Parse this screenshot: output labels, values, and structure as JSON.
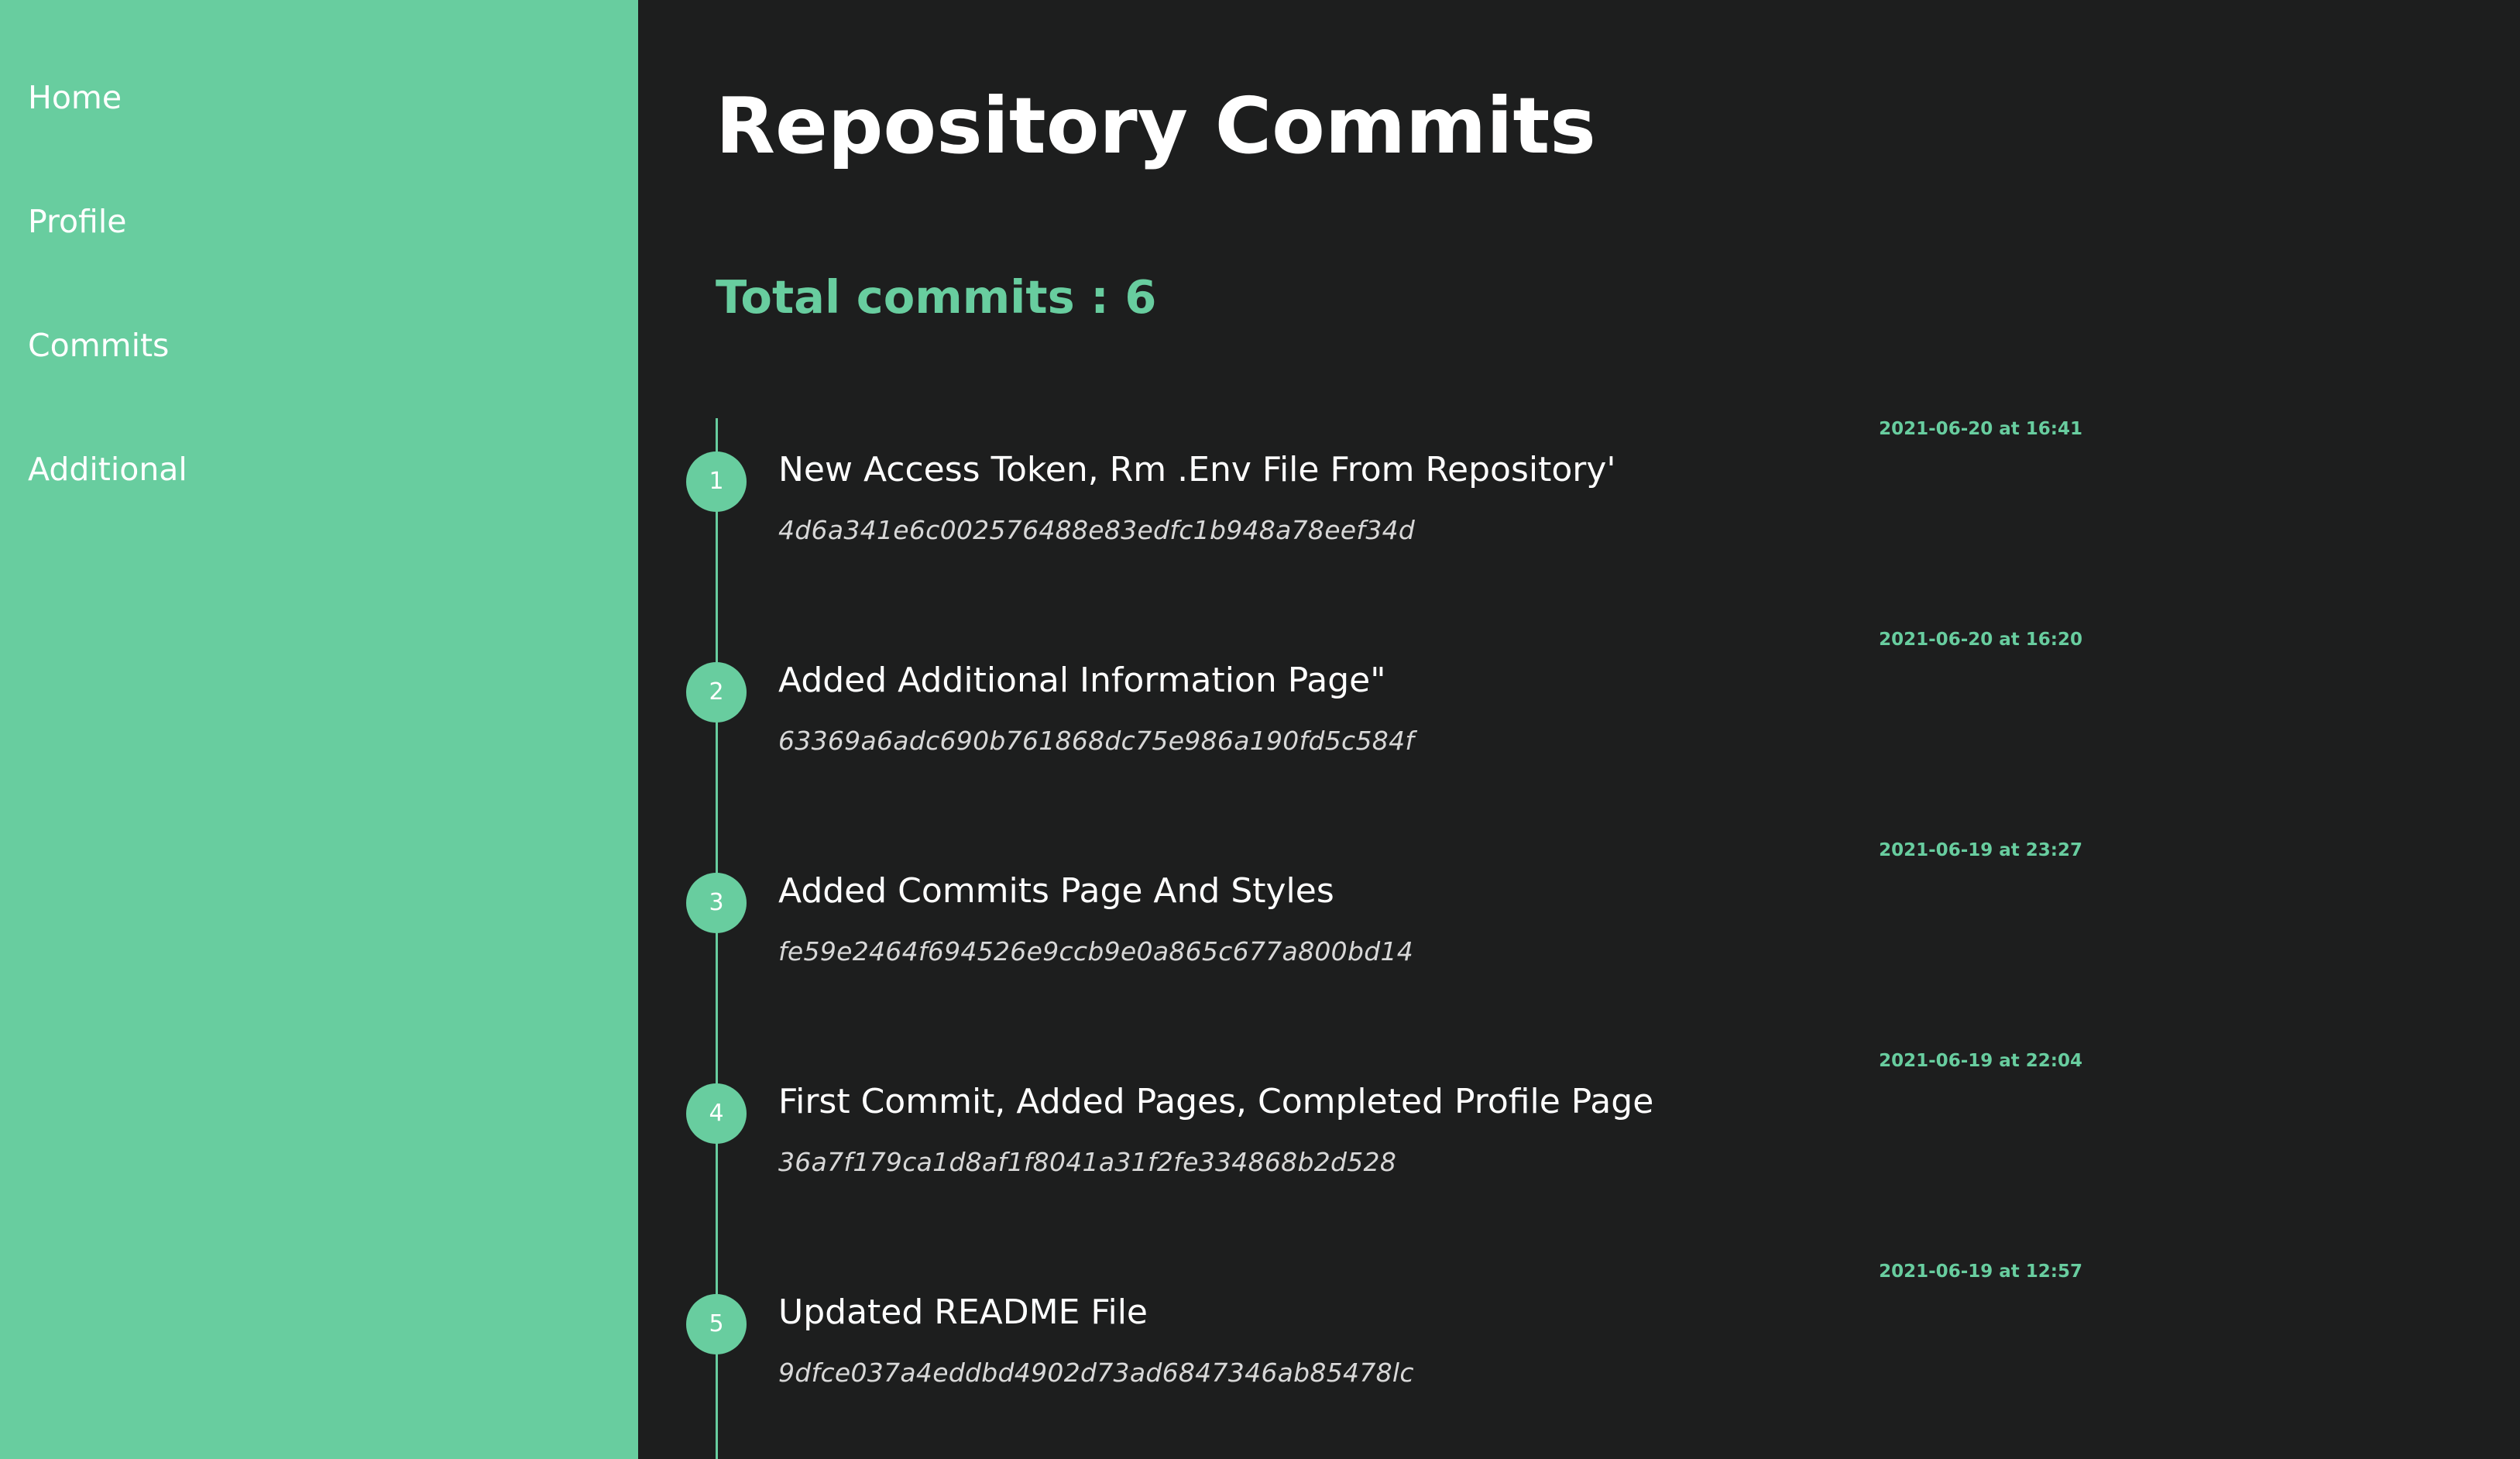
{
  "sidebar": {
    "items": [
      {
        "label": "Home"
      },
      {
        "label": "Profile"
      },
      {
        "label": "Commits"
      },
      {
        "label": "Additional"
      }
    ]
  },
  "main": {
    "title": "Repository Commits",
    "total_label": "Total commits : 6"
  },
  "commits": [
    {
      "number": "1",
      "message": "New Access Token, Rm .Env File From Repository'",
      "sha": "4d6a341e6c002576488e83edfc1b948a78eef34d",
      "date": "2021-06-20 at 16:41"
    },
    {
      "number": "2",
      "message": "Added Additional Information Page\"",
      "sha": "63369a6adc690b761868dc75e986a190fd5c584f",
      "date": "2021-06-20 at 16:20"
    },
    {
      "number": "3",
      "message": "Added Commits Page And Styles",
      "sha": "fe59e2464f694526e9ccb9e0a865c677a800bd14",
      "date": "2021-06-19 at 23:27"
    },
    {
      "number": "4",
      "message": "First Commit, Added Pages, Completed Profile Page",
      "sha": "36a7f179ca1d8af1f8041a31f2fe334868b2d528",
      "date": "2021-06-19 at 22:04"
    },
    {
      "number": "5",
      "message": "Updated README File",
      "sha": "9dfce037a4eddbd4902d73ad6847346ab85478lc",
      "date": "2021-06-19 at 12:57"
    }
  ],
  "colors": {
    "accent": "#68cd9f",
    "background": "#1d1e1e",
    "text": "#ffffff"
  }
}
